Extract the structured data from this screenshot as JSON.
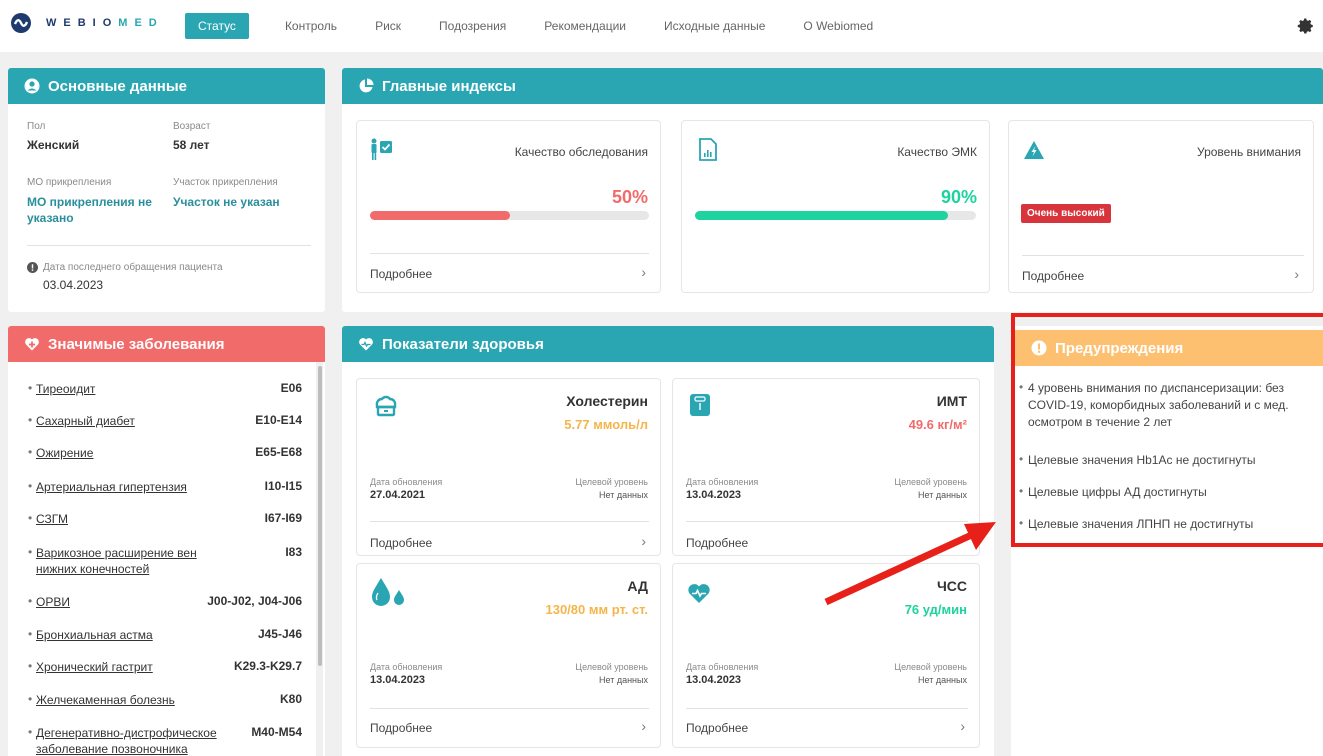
{
  "brand": {
    "prefix": "WEBIO",
    "suffix": "MED"
  },
  "nav": [
    {
      "label": "Статус",
      "active": true
    },
    {
      "label": "Контроль"
    },
    {
      "label": "Риск"
    },
    {
      "label": "Подозрения"
    },
    {
      "label": "Рекомендации"
    },
    {
      "label": "Исходные данные"
    },
    {
      "label": "О Webiomed"
    }
  ],
  "colors": {
    "teal": "#2aa6b3",
    "red": "#f26b6b",
    "orange": "#fcc070",
    "accent_red": "#d7343b",
    "green": "#1ed39e",
    "amber": "#f5b54a"
  },
  "basic": {
    "title": "Основные данные",
    "sex_label": "Пол",
    "sex": "Женский",
    "age_label": "Возраст",
    "age": "58 лет",
    "mo_label": "МО прикрепления",
    "mo_value": "МО прикрепления не указано",
    "area_label": "Участок прикрепления",
    "area_value": "Участок не указан",
    "last_visit_label": "Дата последнего обращения пациента",
    "last_visit": "03.04.2023"
  },
  "indices": {
    "title": "Главные индексы",
    "items": [
      {
        "title": "Качество обследования",
        "value": "50%",
        "progress": 0.5,
        "more": "Подробнее",
        "icon": "examination-icon"
      },
      {
        "title": "Качество ЭМК",
        "value": "90%",
        "progress": 0.9,
        "icon": "emr-document-icon"
      },
      {
        "title": "Уровень внимания",
        "badge": "Очень высокий",
        "more": "Подробнее",
        "icon": "alert-triangle-icon"
      }
    ]
  },
  "diseases": {
    "title": "Значимые заболевания",
    "items": [
      {
        "name": "Тиреоидит",
        "code": "E06"
      },
      {
        "name": "Сахарный диабет",
        "code": "E10-E14"
      },
      {
        "name": "Ожирение",
        "code": "E65-E68"
      },
      {
        "name": "Артериальная гипертензия",
        "code": "I10-I15"
      },
      {
        "name": "СЗГМ",
        "code": "I67-I69"
      },
      {
        "name": "Варикозное расширение вен нижних конечностей",
        "code": "I83"
      },
      {
        "name": "ОРВИ",
        "code": "J00-J02, J04-J06"
      },
      {
        "name": "Бронхиальная астма",
        "code": "J45-J46"
      },
      {
        "name": "Хронический гастрит",
        "code": "K29.3-K29.7"
      },
      {
        "name": "Желчекаменная болезнь",
        "code": "K80"
      },
      {
        "name": "Дегенеративно-дистрофическое заболевание позвоночника",
        "code": "M40-M54"
      }
    ]
  },
  "health": {
    "title": "Показатели здоровья",
    "date_label": "Дата обновления",
    "target_label": "Целевой уровень",
    "no_data": "Нет данных",
    "more": "Подробнее",
    "items": [
      {
        "title": "Холестерин",
        "value": "5.77 ммоль/л",
        "date": "27.04.2021",
        "icon": "cholesterol-icon"
      },
      {
        "title": "ИМТ",
        "value": "49.6 кг/м²",
        "date": "13.04.2023",
        "icon": "scale-icon"
      },
      {
        "title": "АД",
        "value": "130/80 мм рт. ст.",
        "date": "13.04.2023",
        "icon": "blood-drops-icon"
      },
      {
        "title": "ЧСС",
        "value": "76 уд/мин",
        "date": "13.04.2023",
        "icon": "heart-rate-icon"
      }
    ]
  },
  "warnings": {
    "title": "Предупреждения",
    "items": [
      "4 уровень внимания по диспансеризации: без COVID-19, коморбидных заболеваний и с мед. осмотром в течение 2 лет",
      "Целевые значения Hb1Ac не достигнуты",
      "Целевые цифры АД достигнуты",
      "Целевые значения ЛПНП не достигнуты"
    ]
  }
}
